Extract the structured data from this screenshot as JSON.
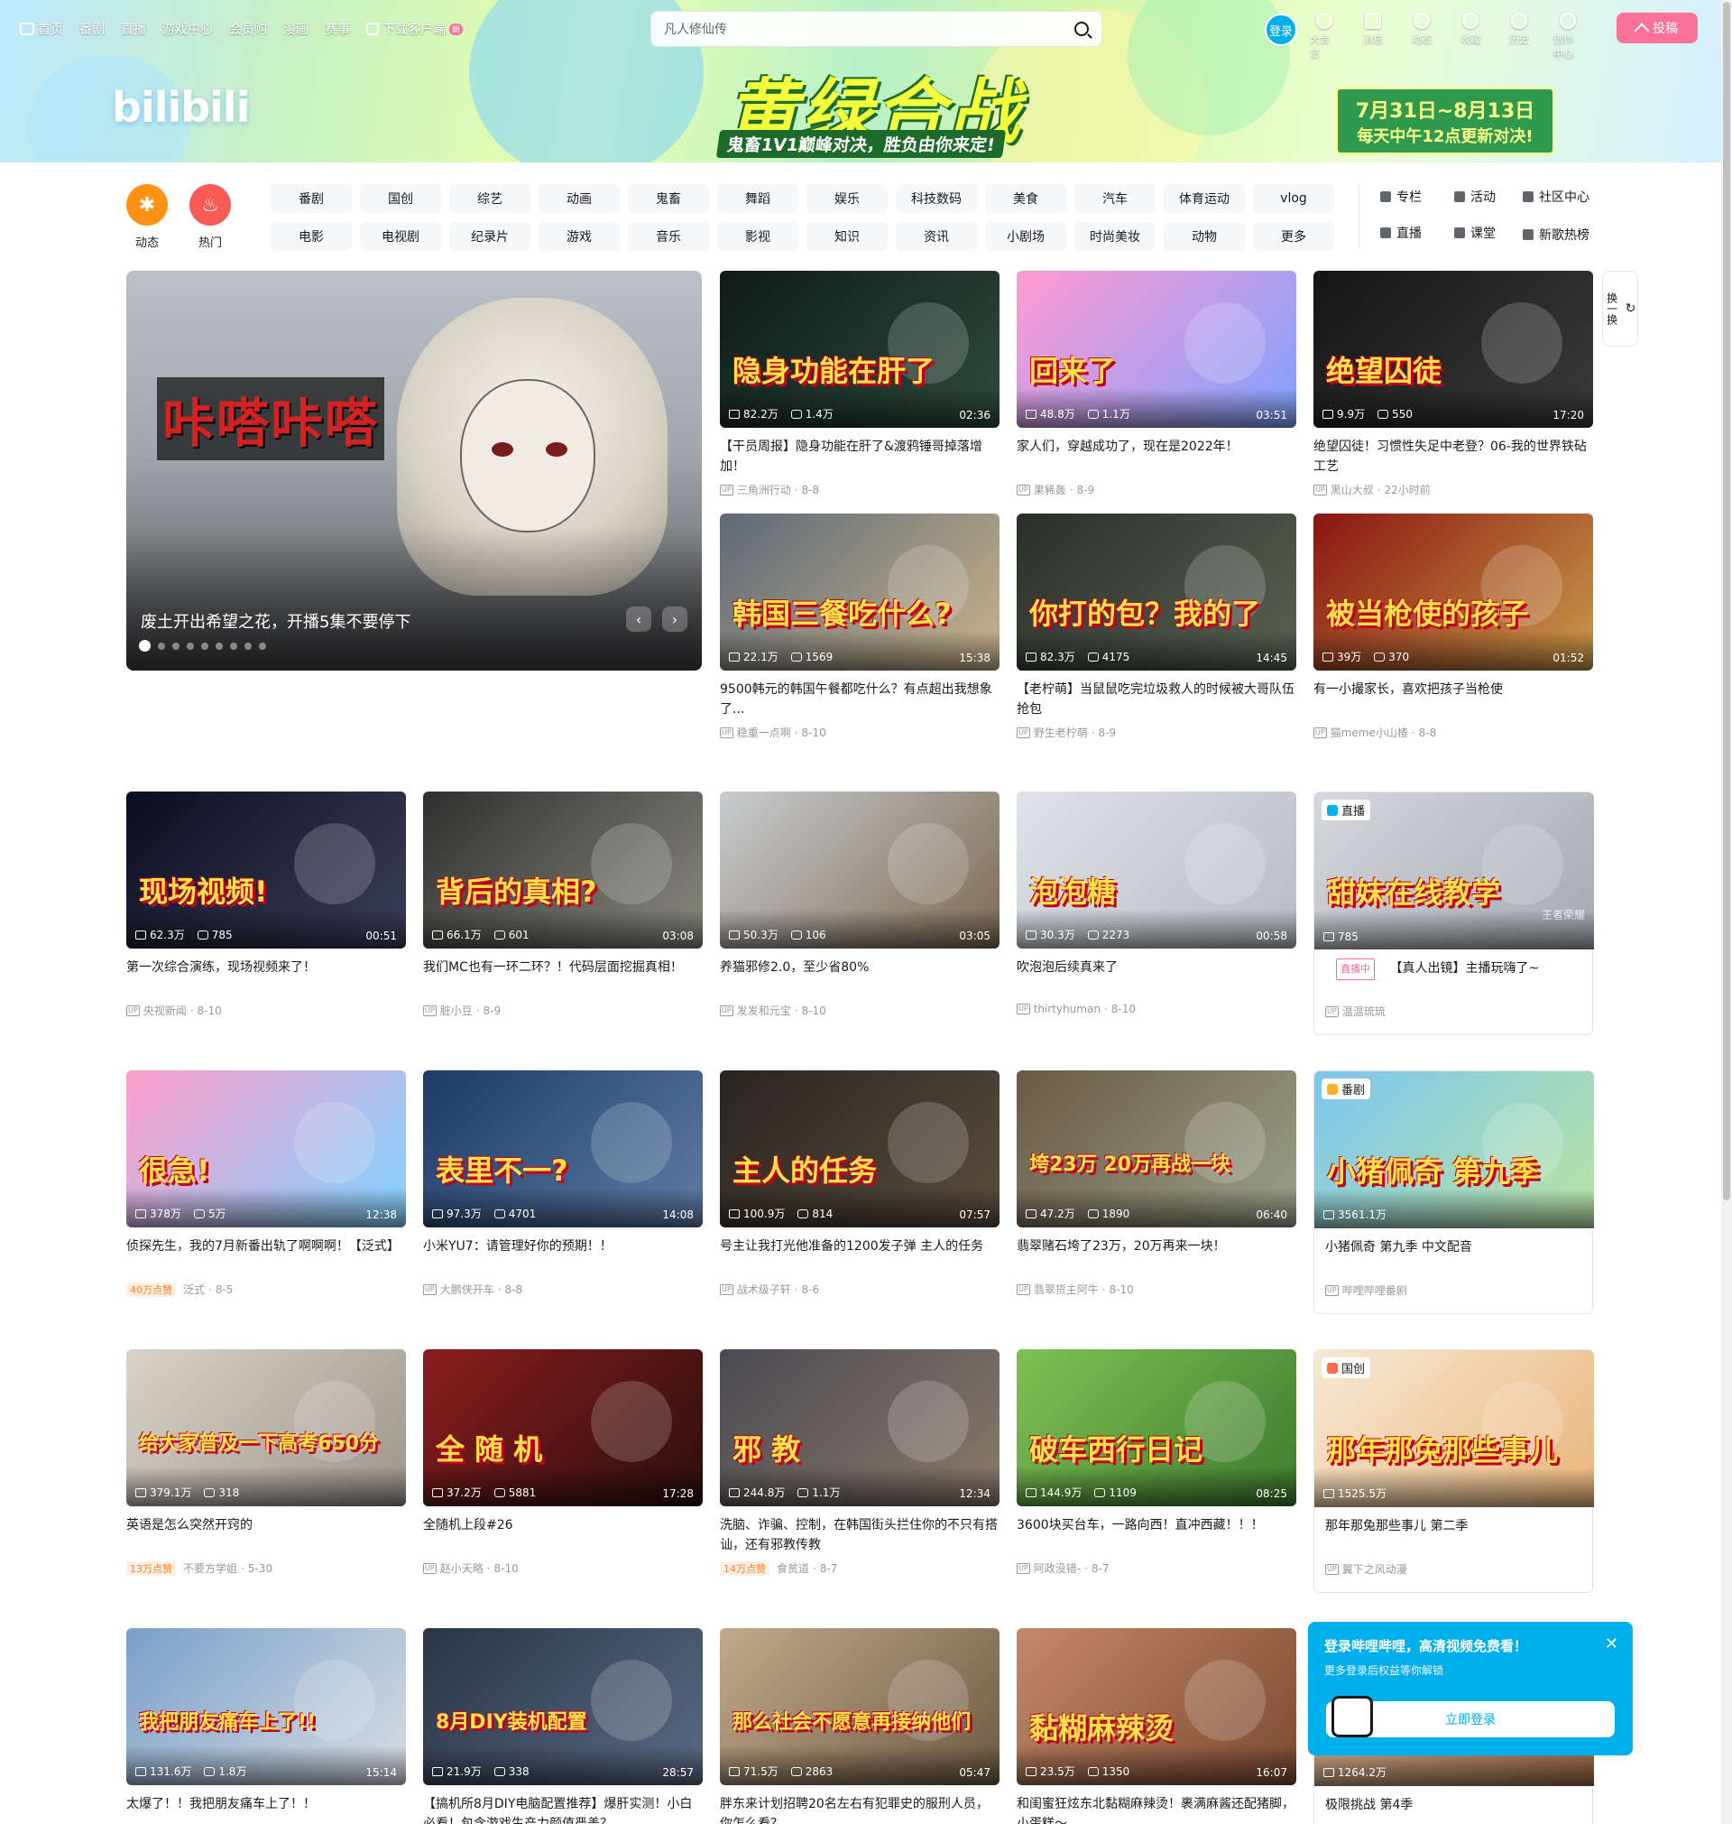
{
  "topnav": {
    "items": [
      "首页",
      "番剧",
      "直播",
      "游戏中心",
      "会员购",
      "漫画",
      "赛事",
      "下载客户端"
    ],
    "new_badge": "新"
  },
  "search": {
    "placeholder": "凡人修仙传"
  },
  "header": {
    "login_label": "登录",
    "icons": [
      "大会员",
      "消息",
      "动态",
      "收藏",
      "历史",
      "创作中心"
    ],
    "upload_label": "投稿"
  },
  "banner": {
    "logo": "bilibili",
    "title": "黄绿合战",
    "subtitle": "鬼畜1V1巅峰对决，胜负由你来定!",
    "date_line1": "7月31日~8月13日",
    "date_line2": "每天中午12点更新对决!"
  },
  "quick": {
    "dynamic": "动态",
    "hot": "热门"
  },
  "channels": [
    "番剧",
    "国创",
    "综艺",
    "动画",
    "鬼畜",
    "舞蹈",
    "娱乐",
    "科技数码",
    "美食",
    "汽车",
    "体育运动",
    "vlog",
    "电影",
    "电视剧",
    "纪录片",
    "游戏",
    "音乐",
    "影视",
    "知识",
    "资讯",
    "小剧场",
    "时尚美妆",
    "动物",
    "更多"
  ],
  "side_links": [
    "专栏",
    "活动",
    "社区中心",
    "直播",
    "课堂",
    "新歌热榜"
  ],
  "carousel": {
    "title": "废土开出希望之花，开播5集不要停下",
    "overlay": "咔嗒咔嗒",
    "dots": 9
  },
  "refresh_label": "换一换",
  "videos": [
    {
      "title": "【干员周报】隐身功能在肝了&渡鸦锤哥掉落增加！",
      "plays": "82.2万",
      "danmaku": "1.4万",
      "duration": "02:36",
      "author": "三角洲行动",
      "date": "8-8",
      "overlay": "隐身功能在肝了",
      "bg1": "#0f1b18",
      "bg2": "#2e4a3d"
    },
    {
      "title": "家人们，穿越成功了，现在是2022年！",
      "plays": "48.8万",
      "danmaku": "1.1万",
      "duration": "03:51",
      "author": "果豨轰",
      "date": "8-9",
      "overlay": "回来了",
      "bg1": "#ff9ad1",
      "bg2": "#7fa2ff"
    },
    {
      "title": "绝望囚徒！习惯性失足中老登？06-我的世界铁砧工艺",
      "plays": "9.9万",
      "danmaku": "550",
      "duration": "17:20",
      "author": "黑山大叔",
      "date": "22小时前",
      "overlay": "绝望囚徒",
      "bg1": "#151515",
      "bg2": "#3b3b3b"
    },
    {
      "title": "9500韩元的韩国午餐都吃什么？有点超出我想象了...",
      "plays": "22.1万",
      "danmaku": "1569",
      "duration": "15:38",
      "author": "稳重一点啊",
      "date": "8-10",
      "overlay": "韩国三餐吃什么?",
      "bg1": "#5d6a78",
      "bg2": "#c9b38a"
    },
    {
      "title": "【老柠萌】当鼠鼠吃完垃圾救人的时候被大哥队伍抢包",
      "plays": "82.3万",
      "danmaku": "4175",
      "duration": "14:45",
      "author": "野生老柠萌",
      "date": "8-9",
      "overlay": "你打的包？我的了",
      "bg1": "#2a2f2a",
      "bg2": "#5a6252"
    },
    {
      "title": "有一小撮家长，喜欢把孩子当枪使",
      "plays": "39万",
      "danmaku": "370",
      "duration": "01:52",
      "author": "猫meme小山楂",
      "date": "8-8",
      "overlay": "被当枪使的孩子",
      "bg1": "#8a1510",
      "bg2": "#c99a4a"
    },
    {
      "title": "第一次综合演练，现场视频来了！",
      "plays": "62.3万",
      "danmaku": "785",
      "duration": "00:51",
      "author": "央视新闻",
      "date": "8-10",
      "overlay": "现场视频!",
      "bg1": "#0a0f1e",
      "bg2": "#3a3f5a"
    },
    {
      "title": "我们MC也有一环二环？！代码层面挖掘真相！",
      "plays": "66.1万",
      "danmaku": "601",
      "duration": "03:08",
      "author": "脏小豆",
      "date": "8-9",
      "overlay": "背后的真相?",
      "bg1": "#2f2f2f",
      "bg2": "#8a8a80"
    },
    {
      "title": "养猫邪修2.0，至少省80%",
      "plays": "50.3万",
      "danmaku": "106",
      "duration": "03:05",
      "author": "发发和元宝",
      "date": "8-10",
      "overlay": "",
      "bg1": "#c8ccd0",
      "bg2": "#7d6a52"
    },
    {
      "title": "吹泡泡后续真来了",
      "plays": "30.3万",
      "danmaku": "2273",
      "duration": "00:58",
      "author": "thirtyhuman",
      "date": "8-10",
      "overlay": "泡泡糖",
      "bg1": "#dfe3e8",
      "bg2": "#b7bcc2"
    },
    {
      "title": "侦探先生，我的7月新番出轨了啊啊啊！【泛式】",
      "plays": "378万",
      "danmaku": "5万",
      "duration": "12:38",
      "author": "泛式",
      "date": "8-5",
      "overlay": "很急!",
      "hot": "40万点赞",
      "bg1": "#ff9ecb",
      "bg2": "#7ed3ff"
    },
    {
      "title": "小米YU7：请管理好你的预期！！",
      "plays": "97.3万",
      "danmaku": "4701",
      "duration": "14:08",
      "author": "大鹏侠开车",
      "date": "8-8",
      "overlay": "表里不一?",
      "bg1": "#1b3a66",
      "bg2": "#5f7da5"
    },
    {
      "title": "号主让我打光他准备的1200发子弹 主人的任务",
      "plays": "100.9万",
      "danmaku": "814",
      "duration": "07:57",
      "author": "战术级子轩",
      "date": "8-6",
      "overlay": "主人的任务",
      "bg1": "#2a2420",
      "bg2": "#5a4e3e"
    },
    {
      "title": "翡翠赌石垮了23万，20万再来一块！",
      "plays": "47.2万",
      "danmaku": "1890",
      "duration": "06:40",
      "author": "翡翠货主阿牛",
      "date": "8-10",
      "overlay": "垮23万 20万再战一块",
      "bg1": "#6b5a44",
      "bg2": "#9aa18a"
    },
    {
      "title": "英语是怎么突然开窍的",
      "plays": "379.1万",
      "danmaku": "318",
      "duration": "",
      "author": "不要方学姐",
      "date": "5-30",
      "overlay": "给大家普及一下高考650分",
      "hot": "13万点赞",
      "bg1": "#d9d4c8",
      "bg2": "#9a948a"
    },
    {
      "title": "全随机上段#26",
      "plays": "37.2万",
      "danmaku": "5881",
      "duration": "17:28",
      "author": "赵小天略",
      "date": "8-10",
      "overlay": "全 随 机",
      "bg1": "#8a1d1d",
      "bg2": "#2a0e0e"
    },
    {
      "title": "洗脑、诈骗、控制，在韩国街头拦住你的不只有搭讪，还有邪教传教",
      "plays": "244.8万",
      "danmaku": "1.1万",
      "duration": "12:34",
      "author": "食贫道",
      "date": "8-7",
      "overlay": "邪 教",
      "hot": "14万点赞",
      "bg1": "#4a4a52",
      "bg2": "#8a7a6a"
    },
    {
      "title": "3600块买台车，一路向西！直冲西藏！！！",
      "plays": "144.9万",
      "danmaku": "1109",
      "duration": "08:25",
      "author": "阿政没错-",
      "date": "8-7",
      "overlay": "破车西行日记",
      "bg1": "#7ec255",
      "bg2": "#3e7a2e"
    },
    {
      "title": "太爆了！！我把朋友痛车上了！！",
      "plays": "131.6万",
      "danmaku": "1.8万",
      "duration": "15:14",
      "author": "",
      "date": "",
      "overlay": "我把朋友痛车上了!!",
      "bg1": "#7aa0c8",
      "bg2": "#d8dde3"
    },
    {
      "title": "【搞机所8月DIY电脑配置推荐】爆肝实测！小白必看！包含游戏生产力颜值严盖？",
      "plays": "21.9万",
      "danmaku": "338",
      "duration": "28:57",
      "author": "",
      "date": "",
      "overlay": "8月DIY装机配置",
      "bg1": "#2a3446",
      "bg2": "#5b6b86"
    },
    {
      "title": "胖东来计划招聘20名左右有犯罪史的服刑人员，你怎么看？",
      "plays": "71.5万",
      "danmaku": "2863",
      "duration": "05:47",
      "author": "",
      "date": "",
      "overlay": "那么社会不愿意再接纳他们",
      "bg1": "#c2a98a",
      "bg2": "#6d5a44"
    },
    {
      "title": "和闺蜜狂炫东北黏糊麻辣烫！裹满麻酱还配猪脚，小蛋糕～",
      "plays": "23.5万",
      "danmaku": "1350",
      "duration": "16:07",
      "author": "",
      "date": "",
      "overlay": "黏糊麻辣烫",
      "bg1": "#c4886a",
      "bg2": "#7a4a30"
    }
  ],
  "specials": [
    {
      "tag": "直播",
      "title": "【真人出镜】主播玩嗨了~",
      "plays": "785",
      "overlay": "甜妹在线教学",
      "corner": "王者荣耀",
      "live": "直播中",
      "author": "温温琉琉",
      "bg1": "#d5d8de",
      "bg2": "#a4a9b1"
    },
    {
      "tag": "番剧",
      "title": "小猪佩奇 第九季 中文配音",
      "plays": "3561.1万",
      "overlay": "小猪佩奇 第九季",
      "author": "哔哩哔哩番剧",
      "bg1": "#7dc6f0",
      "bg2": "#b9e4a2"
    },
    {
      "tag": "国创",
      "title": "那年那兔那些事儿 第二季",
      "plays": "1525.5万",
      "overlay": "那年那兔那些事儿",
      "author": "翼下之风动漫",
      "bg1": "#f7e9d4",
      "bg2": "#e9b57a"
    },
    {
      "tag": "",
      "title": "极限挑战 第4季",
      "plays": "1264.2万",
      "overlay": "",
      "author": "",
      "bg1": "#e6c4a1",
      "bg2": "#9c6b48"
    }
  ],
  "popup": {
    "title": "登录哔哩哔哩，高清视频免费看！",
    "subtitle": "更多登录后权益等你解锁",
    "button": "立即登录"
  }
}
